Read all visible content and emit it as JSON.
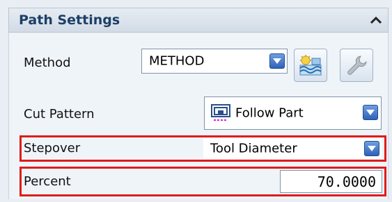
{
  "panel": {
    "title": "Path Settings",
    "collapse_icon": "chevron-up-icon"
  },
  "method": {
    "label": "Method",
    "value": "METHOD",
    "edit_button_icon": "method-display-icon",
    "settings_button_icon": "wrench-icon"
  },
  "cut_pattern": {
    "label": "Cut Pattern",
    "value": "Follow Part",
    "icon": "follow-part-icon"
  },
  "stepover": {
    "label": "Stepover",
    "value": "Tool Diameter"
  },
  "percent": {
    "label": "Percent",
    "value": "70.0000"
  },
  "colors": {
    "highlight": "#e01b1b",
    "title": "#1d3f66",
    "dropdown": "#2e62b8"
  }
}
